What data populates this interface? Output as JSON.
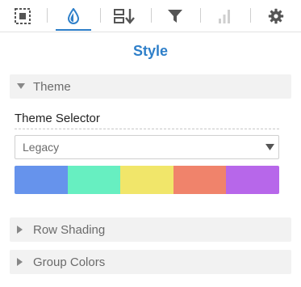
{
  "toolbar": {
    "tabs": [
      {
        "icon": "select-region-icon"
      },
      {
        "icon": "droplet-icon",
        "active": true
      },
      {
        "icon": "sort-icon"
      },
      {
        "icon": "filter-icon"
      },
      {
        "icon": "bar-chart-icon",
        "disabled": true
      },
      {
        "icon": "gear-icon"
      }
    ],
    "accent_color": "#2e7fc9"
  },
  "heading": "Style",
  "theme_section": {
    "title": "Theme",
    "expanded": true,
    "selector_label": "Theme Selector",
    "selected": "Legacy",
    "palette": [
      "#6693ec",
      "#67efc1",
      "#f1e66a",
      "#f0836b",
      "#b767ea"
    ]
  },
  "row_shading": {
    "title": "Row Shading",
    "expanded": false
  },
  "group_colors": {
    "title": "Group Colors",
    "expanded": false
  }
}
